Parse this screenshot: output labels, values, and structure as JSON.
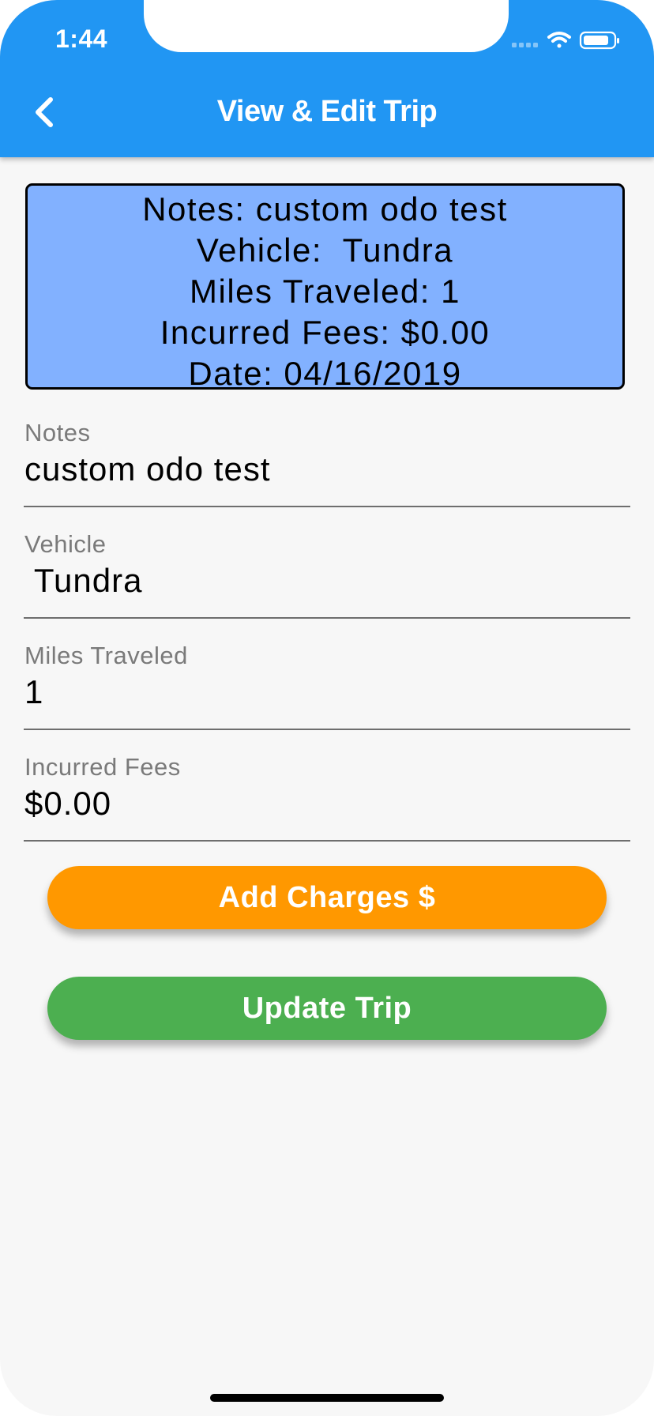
{
  "status_bar": {
    "time": "1:44"
  },
  "app_bar": {
    "title": "View & Edit Trip",
    "back_icon": "chevron-left-icon",
    "color": "#2196f3"
  },
  "summary": {
    "background": "#82b1ff",
    "lines": [
      "Notes: custom odo test",
      "Vehicle:  Tundra",
      "Miles Traveled: 1",
      "Incurred Fees: $0.00",
      "Date: 04/16/2019"
    ]
  },
  "form": {
    "notes": {
      "label": "Notes",
      "value": "custom odo test"
    },
    "vehicle": {
      "label": "Vehicle",
      "value": " Tundra"
    },
    "miles": {
      "label": "Miles Traveled",
      "value": "1"
    },
    "fees": {
      "label": "Incurred Fees",
      "value": "$0.00"
    }
  },
  "buttons": {
    "add_charges": {
      "label": "Add Charges $",
      "color": "#ff9800"
    },
    "update_trip": {
      "label": "Update Trip",
      "color": "#4caf50"
    }
  }
}
